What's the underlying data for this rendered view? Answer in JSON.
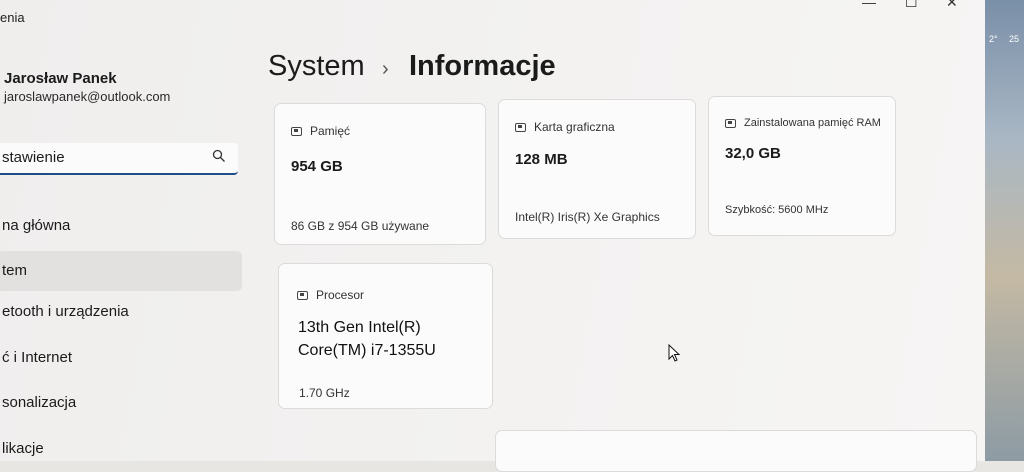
{
  "window": {
    "title_fragment": "enia",
    "controls": [
      "—",
      "☐",
      "✕"
    ]
  },
  "user": {
    "name": "Jarosław Panek",
    "email": "jaroslawpanek@outlook.com"
  },
  "search": {
    "value": "stawienie",
    "icon": "search-icon"
  },
  "sidebar": {
    "items": [
      {
        "label": "na główna"
      },
      {
        "label": "tem",
        "active": true
      },
      {
        "label": "etooth i urządzenia"
      },
      {
        "label": "ć i Internet"
      },
      {
        "label": "sonalizacja"
      },
      {
        "label": "likacje"
      }
    ]
  },
  "breadcrumb": {
    "root": "System",
    "separator": "›",
    "page": "Informacje"
  },
  "cards": {
    "storage": {
      "title": "Pamięć",
      "value": "954 GB",
      "detail": "86 GB z 954 GB używane",
      "icon": "storage-icon"
    },
    "gpu": {
      "title": "Karta graficzna",
      "value": "128 MB",
      "detail": "Intel(R) Iris(R) Xe Graphics",
      "icon": "gpu-icon"
    },
    "ram": {
      "title": "Zainstalowana pamięć RAM",
      "value": "32,0 GB",
      "detail": "Szybkość: 5600 MHz",
      "icon": "ram-icon"
    },
    "cpu": {
      "title": "Procesor",
      "value_line1": "13th Gen Intel(R)",
      "value_line2": "Core(TM) i7-1355U",
      "detail": "1.70 GHz",
      "icon": "cpu-icon"
    }
  },
  "background_strip": {
    "t1": "2°",
    "t2": "25"
  }
}
